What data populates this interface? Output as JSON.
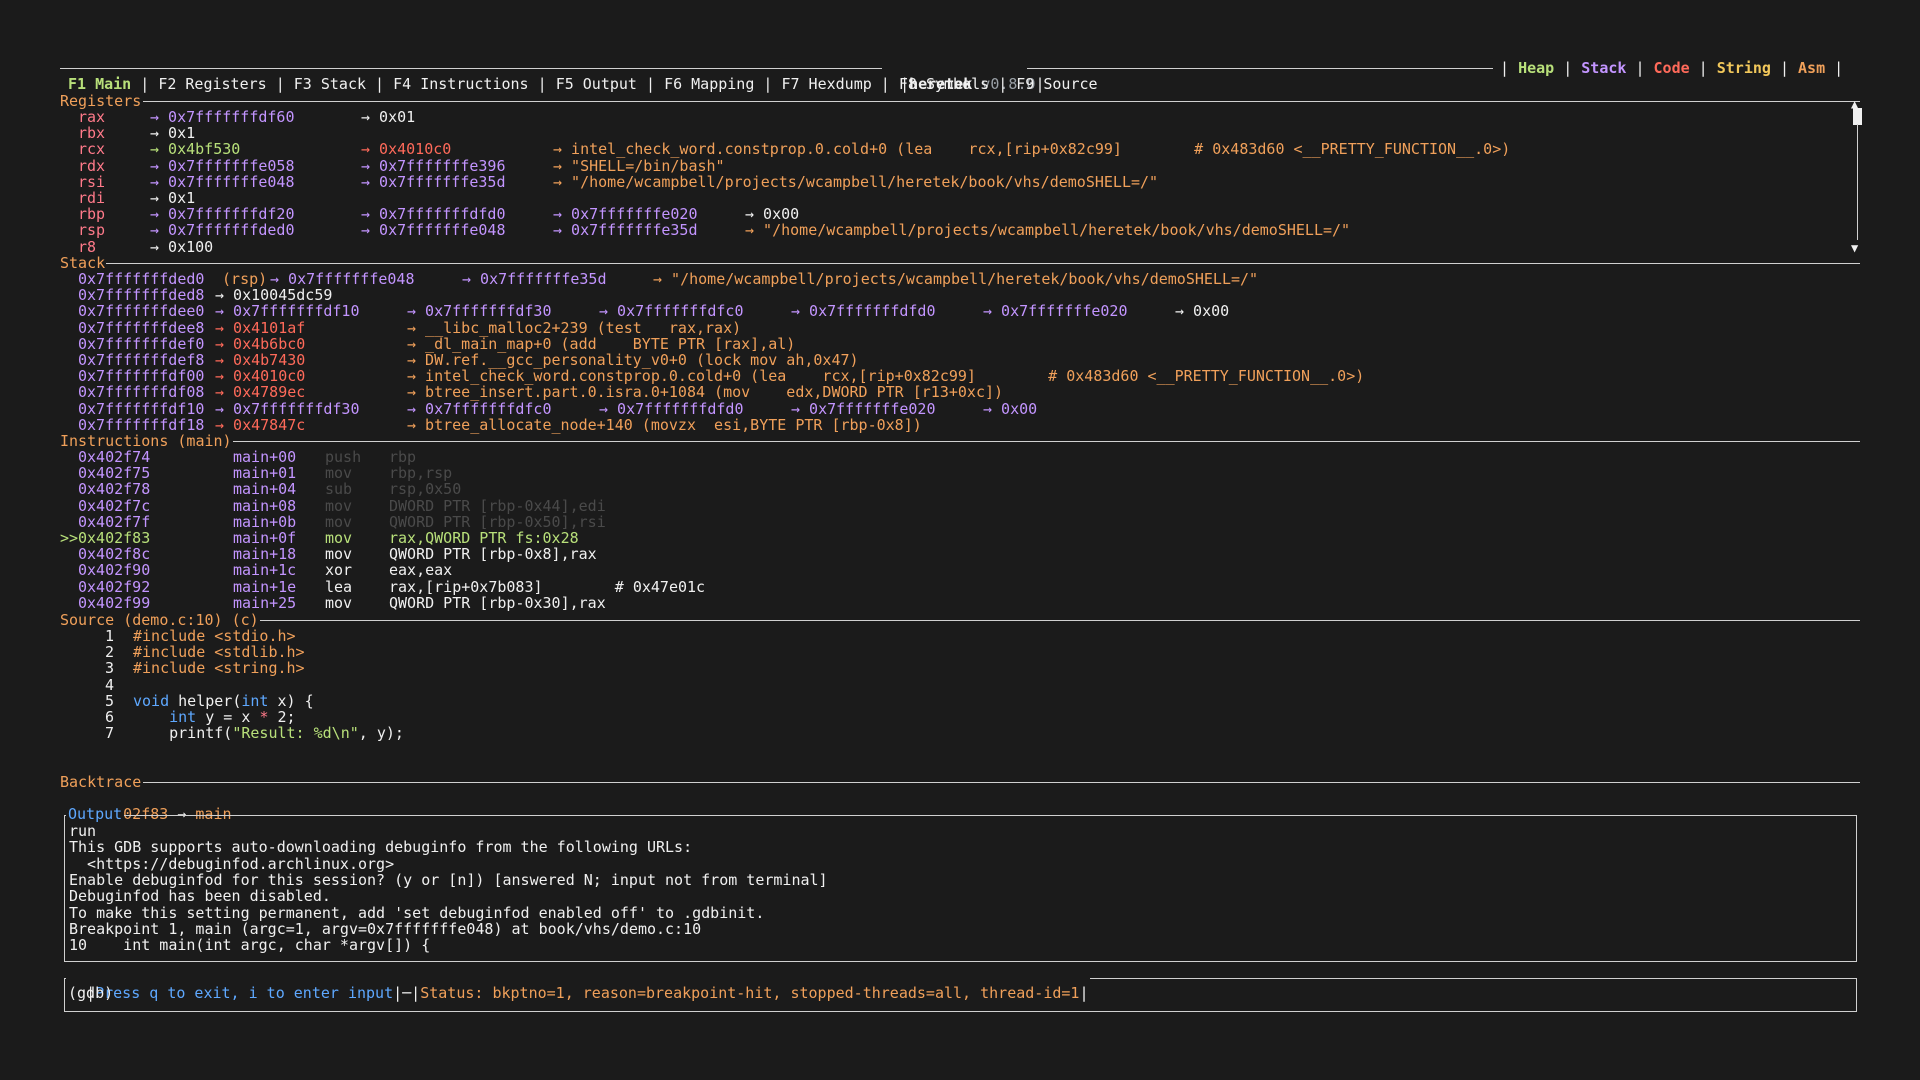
{
  "titlebar": {
    "app": "heretek",
    "version": "v0.8.0"
  },
  "right_tabs": [
    "Heap",
    "Stack",
    "Code",
    "String",
    "Asm"
  ],
  "right_tab_colors": [
    "#b8e07a",
    "#c395ff",
    "#ff6a5a",
    "#f2c85b",
    "#f0a05a"
  ],
  "fkeys": [
    "F1 Main",
    "F2 Registers",
    "F3 Stack",
    "F4 Instructions",
    "F5 Output",
    "F6 Mapping",
    "F7 Hexdump",
    "F8 Symbols",
    "F9 Source"
  ],
  "sections": {
    "registers": "Registers",
    "stack": "Stack",
    "instructions": "Instructions (main)",
    "source": "Source (demo.c:10) (c)",
    "backtrace": "Backtrace",
    "output": "Output"
  },
  "registers": [
    {
      "name": "rax",
      "v1": "→ 0x7fffffffdf60",
      "v2": "→ 0x01",
      "v3": "",
      "v4": "",
      "v5": ""
    },
    {
      "name": "rbx",
      "v1": "→ 0x1",
      "v2": "",
      "v3": "",
      "v4": "",
      "v5": ""
    },
    {
      "name": "rcx",
      "v1": "→ 0x4bf530",
      "v2": "→ 0x4010c0",
      "v3": "→ intel_check_word.constprop.0.cold+0 (lea    rcx,[rip+0x82c99]        # 0x483d60 <__PRETTY_FUNCTION__.0>)",
      "v4": "",
      "v5": ""
    },
    {
      "name": "rdx",
      "v1": "→ 0x7fffffffe058",
      "v2": "→ 0x7fffffffe396",
      "v3": "→ \"SHELL=/bin/bash\"",
      "v4": "",
      "v5": ""
    },
    {
      "name": "rsi",
      "v1": "→ 0x7fffffffe048",
      "v2": "→ 0x7fffffffe35d",
      "v3": "→ \"/home/wcampbell/projects/wcampbell/heretek/book/vhs/demoSHELL=/\"",
      "v4": "",
      "v5": ""
    },
    {
      "name": "rdi",
      "v1": "→ 0x1",
      "v2": "",
      "v3": "",
      "v4": "",
      "v5": ""
    },
    {
      "name": "rbp",
      "v1": "→ 0x7fffffffdf20",
      "v2": "→ 0x7fffffffdfd0",
      "v3": "→ 0x7fffffffe020",
      "v4": "→ 0x00",
      "v5": ""
    },
    {
      "name": "rsp",
      "v1": "→ 0x7fffffffded0",
      "v2": "→ 0x7fffffffe048",
      "v3": "→ 0x7fffffffe35d",
      "v4": "→ \"/home/wcampbell/projects/wcampbell/heretek/book/vhs/demoSHELL=/\"",
      "v5": ""
    },
    {
      "name": "r8",
      "v1": "→ 0x100",
      "v2": "",
      "v3": "",
      "v4": "",
      "v5": ""
    }
  ],
  "stack": [
    {
      "addr": "0x7fffffffded0",
      "a": " (rsp)→ 0x7fffffffe048",
      "b": "→ 0x7fffffffe35d",
      "c": "→ \"/home/wcampbell/projects/wcampbell/heretek/book/vhs/demoSHELL=/\"",
      "d": "",
      "e": ""
    },
    {
      "addr": "0x7fffffffded8",
      "a": "→ 0x10045dc59",
      "b": "",
      "c": "",
      "d": "",
      "e": ""
    },
    {
      "addr": "0x7fffffffdee0",
      "a": "→ 0x7fffffffdf10",
      "b": "→ 0x7fffffffdf30",
      "c": "→ 0x7fffffffdfc0",
      "d": "→ 0x7fffffffdfd0",
      "e": "→ 0x7fffffffe020"
    },
    {
      "addr": "0x7fffffffdee8",
      "a": "→ 0x4101af",
      "b": "→ __libc_malloc2+239 (test   rax,rax)",
      "c": "",
      "d": "",
      "e": ""
    },
    {
      "addr": "0x7fffffffdef0",
      "a": "→ 0x4b6bc0",
      "b": "→ _dl_main_map+0 (add    BYTE PTR [rax],al)",
      "c": "",
      "d": "",
      "e": ""
    },
    {
      "addr": "0x7fffffffdef8",
      "a": "→ 0x4b7430",
      "b": "→ DW.ref.__gcc_personality_v0+0 (lock mov ah,0x47)",
      "c": "",
      "d": "",
      "e": ""
    },
    {
      "addr": "0x7fffffffdf00",
      "a": "→ 0x4010c0",
      "b": "→ intel_check_word.constprop.0.cold+0 (lea    rcx,[rip+0x82c99]        # 0x483d60 <__PRETTY_FUNCTION__.0>)",
      "c": "",
      "d": "",
      "e": ""
    },
    {
      "addr": "0x7fffffffdf08",
      "a": "→ 0x4789ec",
      "b": "→ btree_insert.part.0.isra.0+1084 (mov    edx,DWORD PTR [r13+0xc])",
      "c": "",
      "d": "",
      "e": ""
    },
    {
      "addr": "0x7fffffffdf10",
      "a": "→ 0x7fffffffdf30",
      "b": "→ 0x7fffffffdfc0",
      "c": "→ 0x7fffffffdfd0",
      "d": "→ 0x7fffffffe020",
      "e": "→ 0x00"
    },
    {
      "addr": "0x7fffffffdf18",
      "a": "→ 0x47847c",
      "b": "→ btree_allocate_node+140 (movzx  esi,BYTE PTR [rbp-0x8])",
      "c": "",
      "d": "",
      "e": ""
    }
  ],
  "stack_tail": "→ 0x00",
  "instructions": [
    {
      "prefix": "  ",
      "addr": "0x402f74",
      "off": "main+00",
      "op": "push",
      "args": "rbp"
    },
    {
      "prefix": "  ",
      "addr": "0x402f75",
      "off": "main+01",
      "op": "mov",
      "args": "rbp,rsp"
    },
    {
      "prefix": "  ",
      "addr": "0x402f78",
      "off": "main+04",
      "op": "sub",
      "args": "rsp,0x50"
    },
    {
      "prefix": "  ",
      "addr": "0x402f7c",
      "off": "main+08",
      "op": "mov",
      "args": "DWORD PTR [rbp-0x44],edi"
    },
    {
      "prefix": "  ",
      "addr": "0x402f7f",
      "off": "main+0b",
      "op": "mov",
      "args": "QWORD PTR [rbp-0x50],rsi"
    },
    {
      "prefix": ">>",
      "addr": "0x402f83",
      "off": "main+0f",
      "op": "mov",
      "args": "rax,QWORD PTR fs:0x28"
    },
    {
      "prefix": "  ",
      "addr": "0x402f8c",
      "off": "main+18",
      "op": "mov",
      "args": "QWORD PTR [rbp-0x8],rax"
    },
    {
      "prefix": "  ",
      "addr": "0x402f90",
      "off": "main+1c",
      "op": "xor",
      "args": "eax,eax"
    },
    {
      "prefix": "  ",
      "addr": "0x402f92",
      "off": "main+1e",
      "op": "lea",
      "args": "rax,[rip+0x7b083]        # 0x47e01c"
    },
    {
      "prefix": "  ",
      "addr": "0x402f99",
      "off": "main+25",
      "op": "mov",
      "args": "QWORD PTR [rbp-0x30],rax"
    }
  ],
  "source": [
    {
      "num": "1",
      "text": "#include <stdio.h>"
    },
    {
      "num": "2",
      "text": "#include <stdlib.h>"
    },
    {
      "num": "3",
      "text": "#include <string.h>"
    },
    {
      "num": "4",
      "text": ""
    },
    {
      "num": "5",
      "text": "void helper(int x) {"
    },
    {
      "num": "6",
      "text": "    int y = x * 2;"
    },
    {
      "num": "7",
      "text": "    printf(\"Result: %d\\n\", y);"
    }
  ],
  "backtrace": {
    "addr": "00402f83",
    "arrow": "→",
    "func": "main"
  },
  "output_lines": [
    "run",
    "This GDB supports auto-downloading debuginfo from the following URLs:",
    "  <https://debuginfod.archlinux.org>",
    "Enable debuginfod for this session? (y or [n]) [answered N; input not from terminal]",
    "Debuginfod has been disabled.",
    "To make this setting permanent, add 'set debuginfod enabled off' to .gdbinit.",
    "Breakpoint 1, main (argc=1, argv=0x7fffffffe048) at book/vhs/demo.c:10",
    "10    int main(int argc, char *argv[]) {"
  ],
  "input": {
    "hint": "Press q to exit, i to enter input",
    "status": "Status: bkptno=1, reason=breakpoint-hit, stopped-threads=all, thread-id=1",
    "prompt": "(gdb)"
  }
}
